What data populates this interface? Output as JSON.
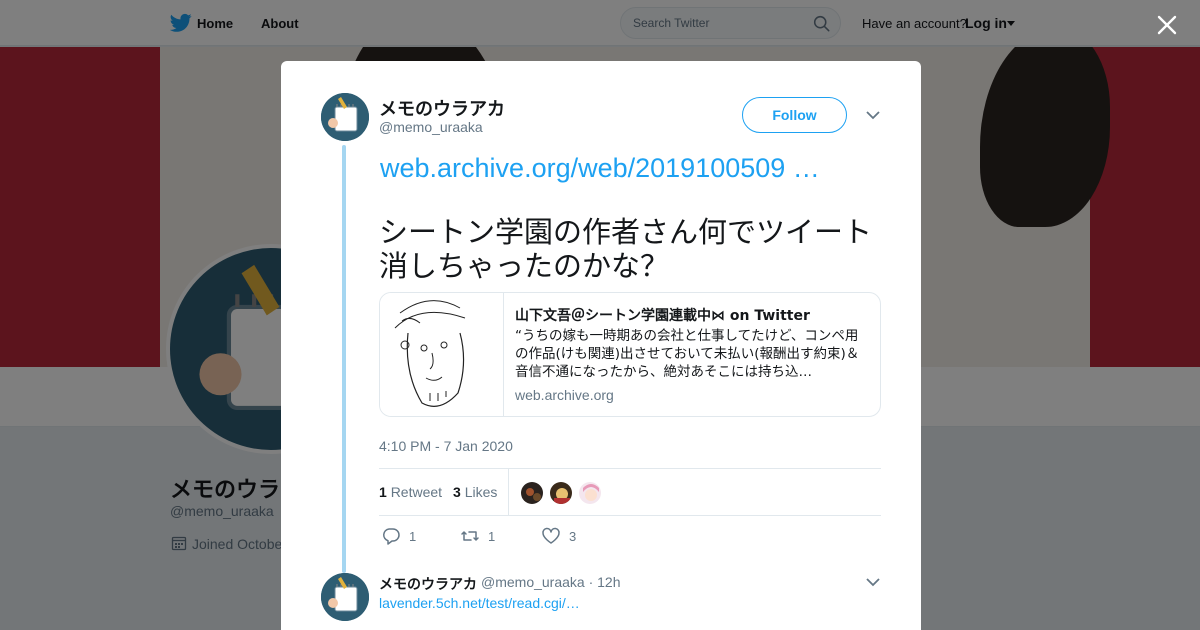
{
  "topbar": {
    "home_label": "Home",
    "about_label": "About",
    "search_placeholder": "Search Twitter",
    "have_account": "Have an account?",
    "login_label": "Log in"
  },
  "profile_bg": {
    "name": "メモのウラアカ",
    "handle": "@memo_uraaka",
    "joined": "Joined Octobe"
  },
  "tweet": {
    "author": {
      "name": "メモのウラアカ",
      "handle": "@memo_uraaka"
    },
    "follow_label": "Follow",
    "link_text": "web.archive.org/web/2019100509 …",
    "text": "シートン学園の作者さん何でツイート消しちゃったのかな？",
    "card": {
      "title": "山下文吾＠シートン学園連載中⋈ on Twitter",
      "description": "“うちの嫁も一時期あの会社と仕事してたけど、コンペ用の作品(けも関連)出させておいて未払い(報酬出す約束)＆音信不通になったから、絶対あそこには持ち込…",
      "domain": "web.archive.org"
    },
    "timestamp": "4:10 PM - 7 Jan 2020",
    "retweets": {
      "count": "1",
      "label": "Retweet"
    },
    "likes": {
      "count": "3",
      "label": "Likes"
    },
    "actions": {
      "reply_count": "1",
      "retweet_count": "1",
      "like_count": "3"
    }
  },
  "reply": {
    "name": "メモのウラアカ",
    "meta": "@memo_uraaka · 12h",
    "link_text": "lavender.5ch.net/test/read.cgi/…"
  },
  "colors": {
    "accent": "#1da1f2",
    "thread_line": "#a5d6f1",
    "banner": "#b8283a"
  },
  "icons": [
    "twitter-bird-icon",
    "search-icon",
    "close-icon",
    "chevron-down-icon",
    "reply-icon",
    "retweet-icon",
    "heart-icon",
    "calendar-icon"
  ]
}
